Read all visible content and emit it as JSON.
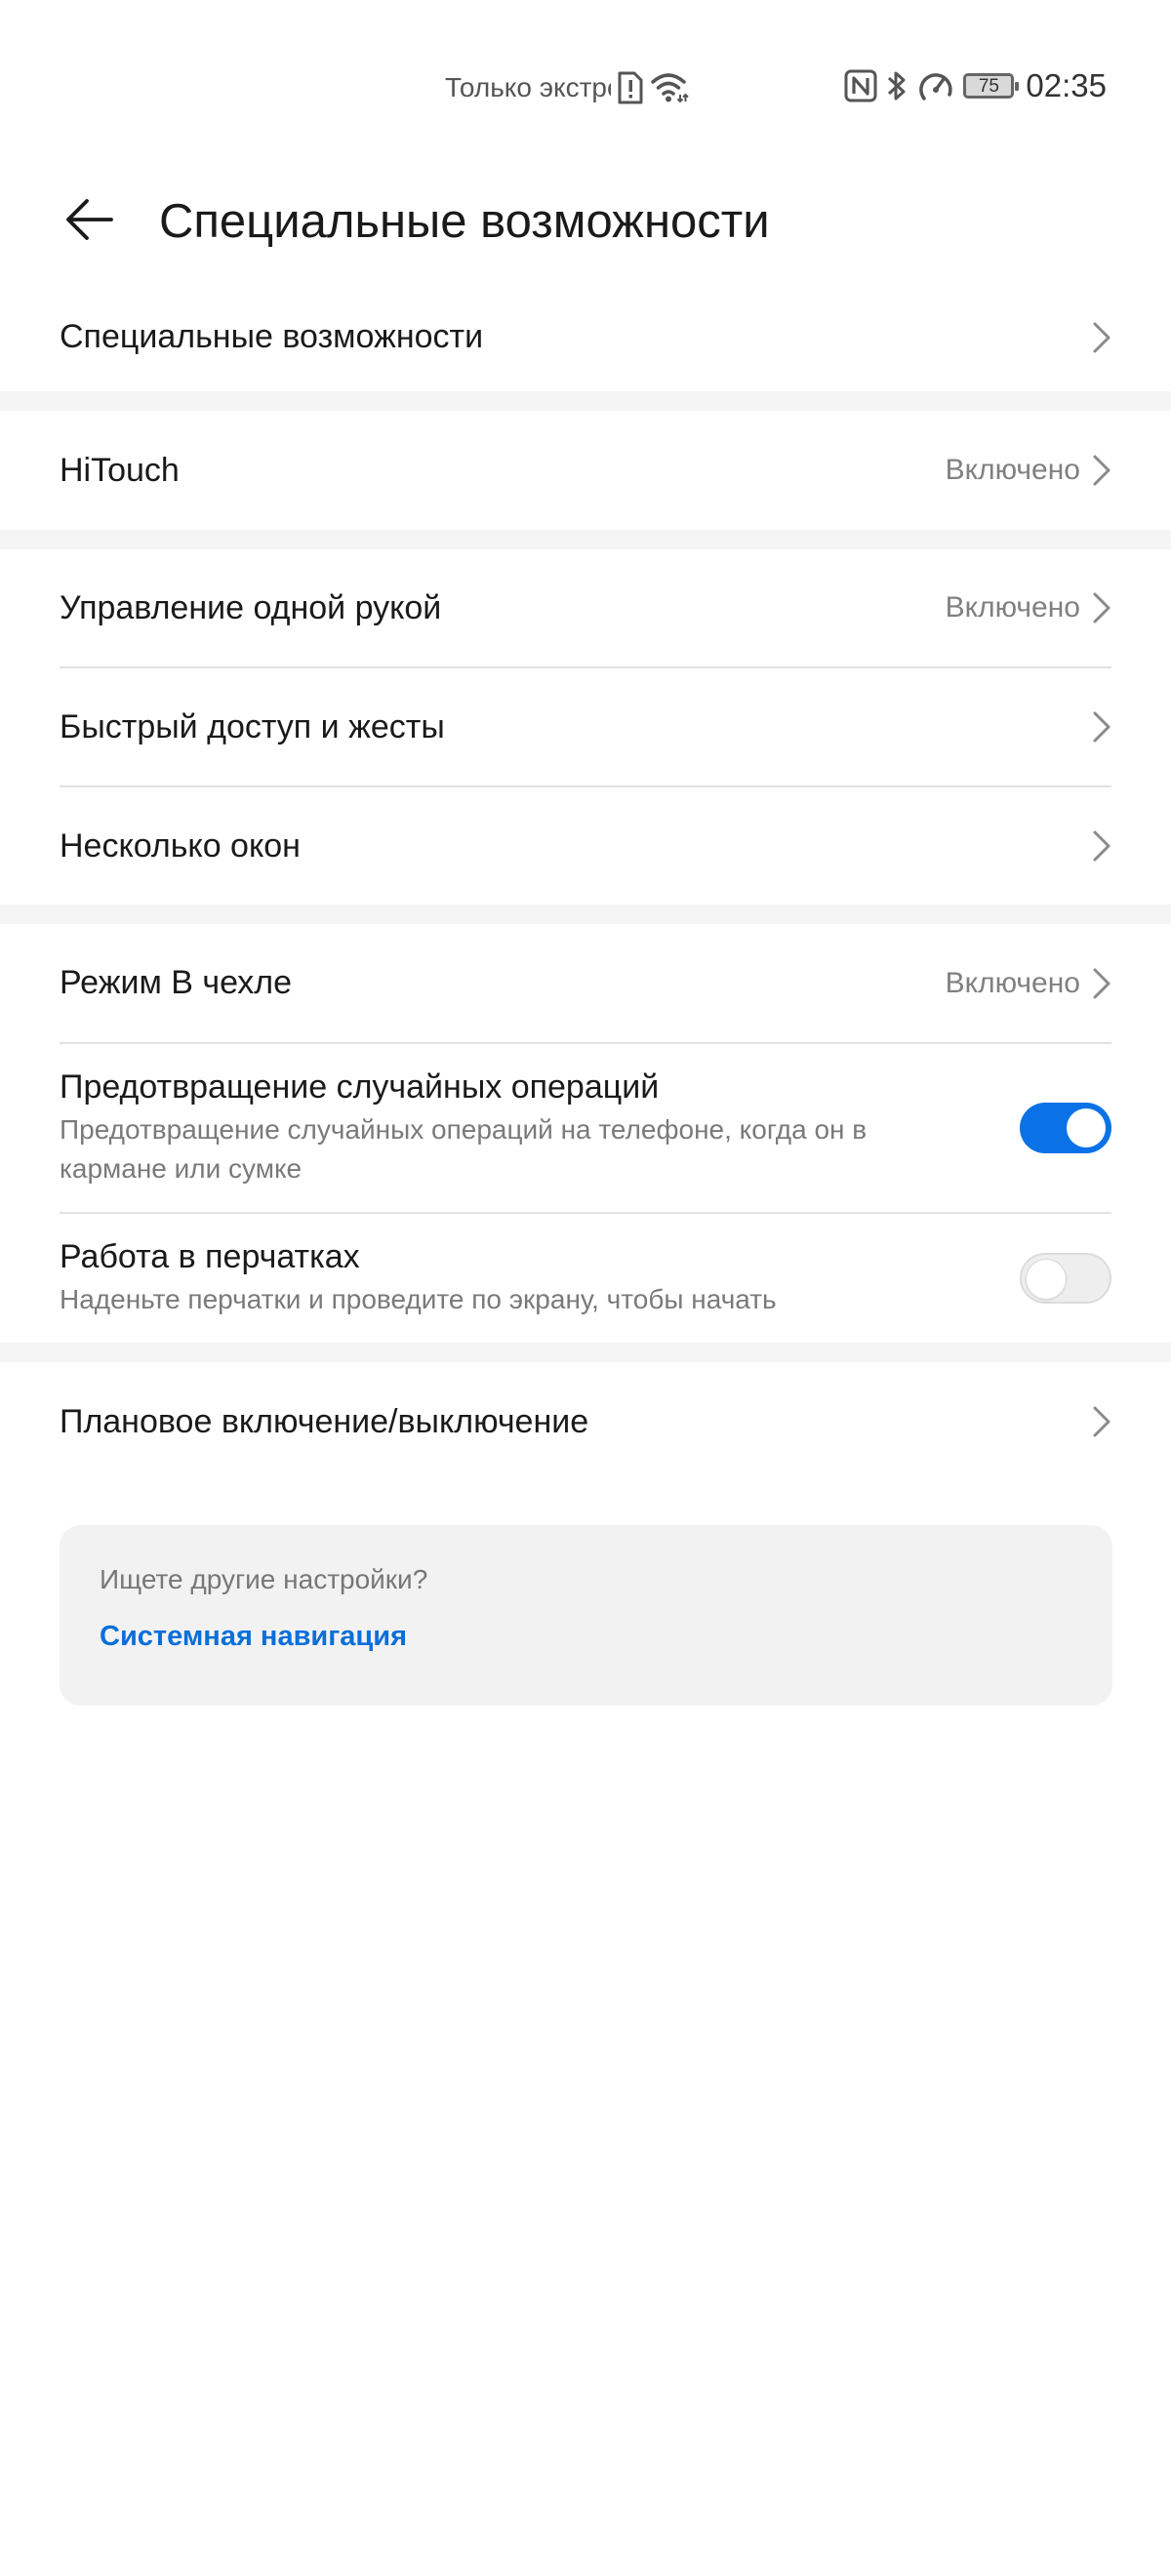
{
  "status_bar": {
    "carrier": "Только экстренные вызовы",
    "battery_level": "75",
    "time": "02:35",
    "icons": [
      "sim-alert-icon",
      "wifi-icon",
      "nfc-icon",
      "bluetooth-icon",
      "speed-icon",
      "battery-icon"
    ]
  },
  "header": {
    "title": "Специальные возможности",
    "back_icon": "arrow-left-icon"
  },
  "groups": {
    "g1": {
      "accessibility": {
        "label": "Специальные возможности"
      }
    },
    "g2": {
      "hitouch": {
        "label": "HiTouch",
        "value": "Включено"
      }
    },
    "g3": {
      "one_hand": {
        "label": "Управление одной рукой",
        "value": "Включено"
      },
      "shortcuts": {
        "label": "Быстрый доступ и жесты"
      },
      "multi_window": {
        "label": "Несколько окон"
      }
    },
    "g4": {
      "cover_mode": {
        "label": "Режим В чехле",
        "value": "Включено"
      },
      "accidental": {
        "label": "Предотвращение случайных операций",
        "description": "Предотвращение случайных операций на телефоне, когда он в кармане или сумке",
        "enabled": true
      },
      "gloves": {
        "label": "Работа в перчатках",
        "description": "Наденьте перчатки и проведите по экрану, чтобы начать",
        "enabled": false
      }
    },
    "g5": {
      "scheduled": {
        "label": "Плановое включение/выключение"
      }
    }
  },
  "suggestion": {
    "question": "Ищете другие настройки?",
    "link": "Системная навигация"
  },
  "colors": {
    "accent": "#0a72e6",
    "link": "#0a6fd8",
    "divider": "#e2e2e2",
    "section_gap": "#f5f5f5",
    "card_bg": "#f2f2f2"
  }
}
